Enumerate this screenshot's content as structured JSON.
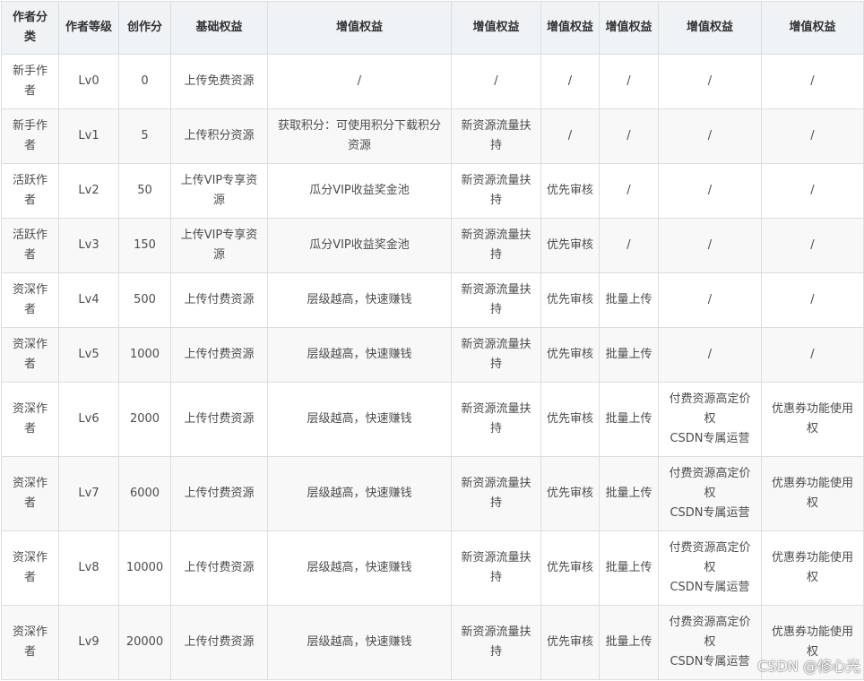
{
  "headers": [
    "作者分类",
    "作者等级",
    "创作分",
    "基础权益",
    "增值权益",
    "增值权益",
    "增值权益",
    "增值权益",
    "增值权益",
    "增值权益"
  ],
  "rows": [
    {
      "category": "新手作者",
      "level": "Lv0",
      "score": "0",
      "basic": "上传免费资源",
      "v1": "/",
      "v2": "/",
      "v3": "/",
      "v4": "/",
      "v5": [
        "/"
      ],
      "v6": "/"
    },
    {
      "category": "新手作者",
      "level": "Lv1",
      "score": "5",
      "basic": "上传积分资源",
      "v1": "获取积分：可使用积分下载积分资源",
      "v2": "新资源流量扶持",
      "v3": "/",
      "v4": "/",
      "v5": [
        "/"
      ],
      "v6": "/"
    },
    {
      "category": "活跃作者",
      "level": "Lv2",
      "score": "50",
      "basic": "上传VIP专享资源",
      "v1": "瓜分VIP收益奖金池",
      "v2": "新资源流量扶持",
      "v3": "优先审核",
      "v4": "/",
      "v5": [
        "/"
      ],
      "v6": "/"
    },
    {
      "category": "活跃作者",
      "level": "Lv3",
      "score": "150",
      "basic": "上传VIP专享资源",
      "v1": "瓜分VIP收益奖金池",
      "v2": "新资源流量扶持",
      "v3": "优先审核",
      "v4": "/",
      "v5": [
        "/"
      ],
      "v6": "/"
    },
    {
      "category": "资深作者",
      "level": "Lv4",
      "score": "500",
      "basic": "上传付费资源",
      "v1": "层级越高，快速赚钱",
      "v2": "新资源流量扶持",
      "v3": "优先审核",
      "v4": "批量上传",
      "v5": [
        "/"
      ],
      "v6": "/"
    },
    {
      "category": "资深作者",
      "level": "Lv5",
      "score": "1000",
      "basic": "上传付费资源",
      "v1": "层级越高，快速赚钱",
      "v2": "新资源流量扶持",
      "v3": "优先审核",
      "v4": "批量上传",
      "v5": [
        "/"
      ],
      "v6": "/"
    },
    {
      "category": "资深作者",
      "level": "Lv6",
      "score": "2000",
      "basic": "上传付费资源",
      "v1": "层级越高，快速赚钱",
      "v2": "新资源流量扶持",
      "v3": "优先审核",
      "v4": "批量上传",
      "v5": [
        "付费资源高定价权",
        "CSDN专属运营"
      ],
      "v6": "优惠券功能使用权"
    },
    {
      "category": "资深作者",
      "level": "Lv7",
      "score": "6000",
      "basic": "上传付费资源",
      "v1": "层级越高，快速赚钱",
      "v2": "新资源流量扶持",
      "v3": "优先审核",
      "v4": "批量上传",
      "v5": [
        "付费资源高定价权",
        "CSDN专属运营"
      ],
      "v6": "优惠券功能使用权"
    },
    {
      "category": "资深作者",
      "level": "Lv8",
      "score": "10000",
      "basic": "上传付费资源",
      "v1": "层级越高，快速赚钱",
      "v2": "新资源流量扶持",
      "v3": "优先审核",
      "v4": "批量上传",
      "v5": [
        "付费资源高定价权",
        "CSDN专属运营"
      ],
      "v6": "优惠券功能使用权"
    },
    {
      "category": "资深作者",
      "level": "Lv9",
      "score": "20000",
      "basic": "上传付费资源",
      "v1": "层级越高，快速赚钱",
      "v2": "新资源流量扶持",
      "v3": "优先审核",
      "v4": "批量上传",
      "v5": [
        "付费资源高定价权",
        "CSDN专属运营"
      ],
      "v6": "优惠券功能使用权"
    }
  ],
  "watermark": "CSDN @修心光"
}
